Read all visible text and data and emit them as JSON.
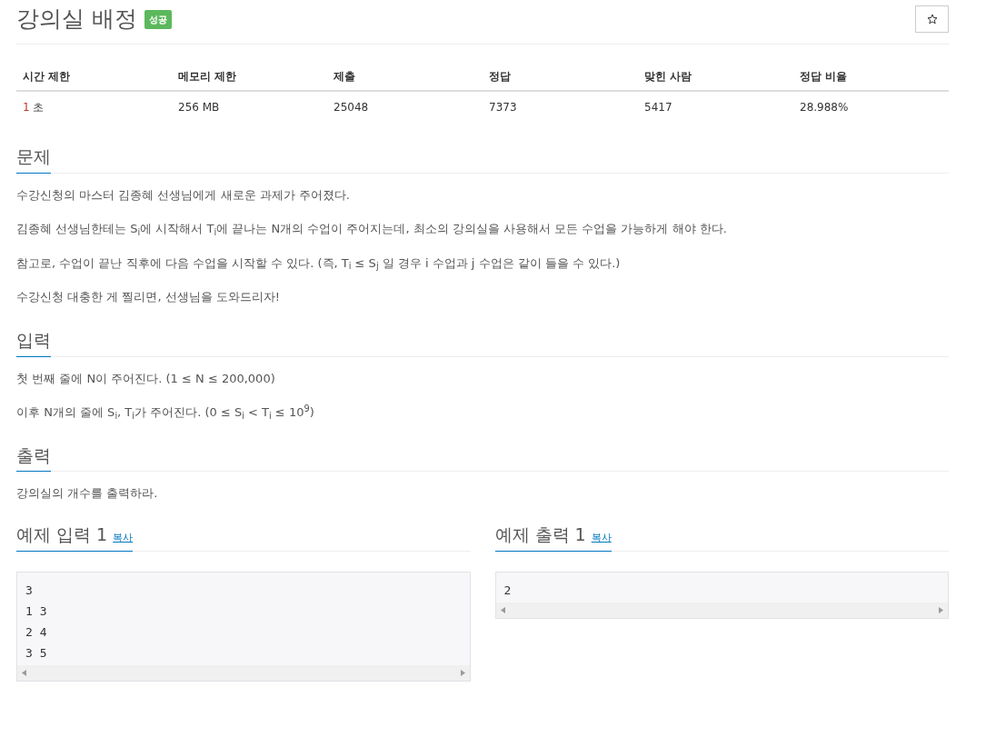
{
  "title": "강의실 배정",
  "result_badge": "성공",
  "stats": {
    "columns": [
      "시간 제한",
      "메모리 제한",
      "제출",
      "정답",
      "맞힌 사람",
      "정답 비율"
    ],
    "time_limit": {
      "value": "1",
      "unit": "초"
    },
    "cells": [
      "256 MB",
      "25048",
      "7373",
      "5417",
      "28.988%"
    ]
  },
  "sections": [
    {
      "heading": "문제",
      "paragraphs": [
        "수강신청의 마스터 김종혜 선생님에게 새로운 과제가 주어졌다.",
        "김종혜 선생님한테는 S$_{i}$에 시작해서 T$_{i}$에 끝나는 N개의 수업이 주어지는데, 최소의 강의실을 사용해서 모든 수업을 가능하게 해야 한다.",
        "참고로, 수업이 끝난 직후에 다음 수업을 시작할 수 있다. (즉, T$_{i}$ ≤ S$_{j}$ 일 경우 i 수업과 j 수업은 같이 들을 수 있다.)",
        "수강신청 대충한 게 찔리면, 선생님을 도와드리자!"
      ]
    },
    {
      "heading": "입력",
      "paragraphs": [
        "첫 번째 줄에 N이 주어진다. (1 ≤ N ≤ 200,000)",
        "이후 N개의 줄에 S$_{i}$, T$_{i}$가 주어진다. (0 ≤ S$_{i}$ < T$_{i}$ ≤ 10$^{9}$)"
      ]
    },
    {
      "heading": "출력",
      "paragraphs": [
        "강의실의 개수를 출력하라."
      ]
    }
  ],
  "samples": [
    {
      "heading": "예제 입력 1",
      "copy": "복사",
      "lines": [
        "3",
        "1 3",
        "2 4",
        "3 5"
      ]
    },
    {
      "heading": "예제 출력 1",
      "copy": "복사",
      "lines": [
        "2"
      ]
    }
  ]
}
